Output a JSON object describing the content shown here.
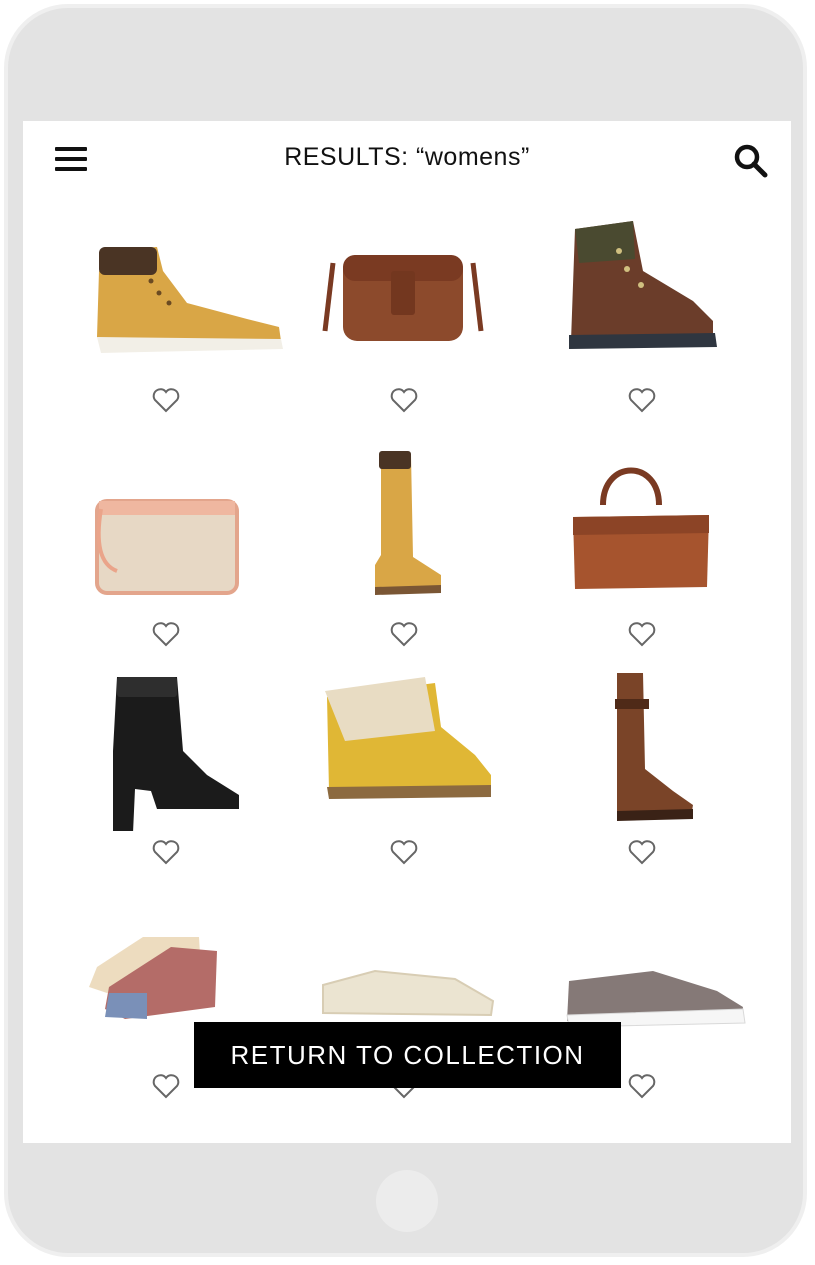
{
  "header": {
    "title": "RESULTS: “womens”",
    "menu_icon": "hamburger-menu-icon",
    "search_icon": "search-icon"
  },
  "products": [
    {
      "id": "p1",
      "kind": "ankle-boot-wheat"
    },
    {
      "id": "p2",
      "kind": "leather-crossbody-bag"
    },
    {
      "id": "p3",
      "kind": "hiking-boot-brown"
    },
    {
      "id": "p4",
      "kind": "canvas-pouch"
    },
    {
      "id": "p5",
      "kind": "tall-lace-boot-wheat"
    },
    {
      "id": "p6",
      "kind": "leather-duffel-bag"
    },
    {
      "id": "p7",
      "kind": "heeled-lace-boot-black"
    },
    {
      "id": "p8",
      "kind": "roll-top-boot-wheat"
    },
    {
      "id": "p9",
      "kind": "tall-lace-boot-brown"
    },
    {
      "id": "p10",
      "kind": "ankle-socks"
    },
    {
      "id": "p11",
      "kind": "perforated-slip-on"
    },
    {
      "id": "p12",
      "kind": "canvas-sneaker-grey"
    }
  ],
  "footer": {
    "return_label": "RETURN TO COLLECTION"
  },
  "colors": {
    "wheat": "#d9a646",
    "brown": "#8a4a2a",
    "black": "#1b1b1b",
    "device": "#e3e3e3"
  }
}
